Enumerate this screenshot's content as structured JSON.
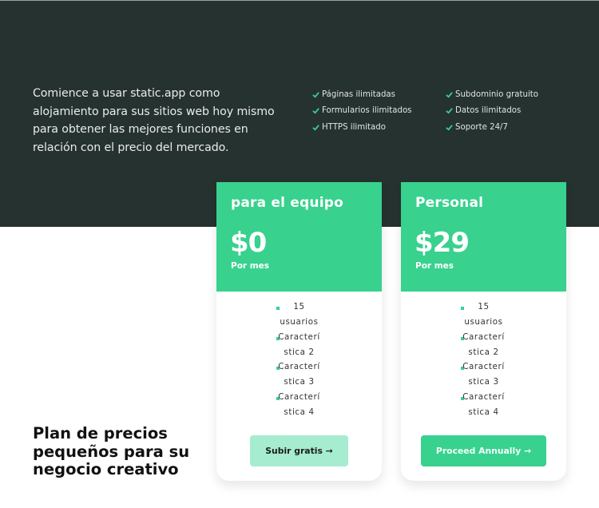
{
  "colors": {
    "dark_bg": "#263230",
    "accent": "#38d18e",
    "accent_light": "#a6ecd0"
  },
  "intro_text": "Comience a usar static.app como alojamiento para sus sitios web hoy mismo para obtener las mejores funciones en relación con el precio del mercado.",
  "features": {
    "col1": [
      "Páginas ilimitadas",
      "Formularios ilimitados",
      "HTTPS ilimitado"
    ],
    "col2": [
      "Subdominio gratuito",
      "Datos ilimitados",
      "Soporte 24/7"
    ]
  },
  "plans": [
    {
      "name": "para el equipo",
      "price": "$0",
      "period": "Por mes",
      "items": [
        [
          "15",
          "usuarios"
        ],
        [
          "Caracterí",
          "stica 2"
        ],
        [
          "Caracterí",
          "stica 3"
        ],
        [
          "Caracterí",
          "stica 4"
        ]
      ],
      "button": "Subir gratis →"
    },
    {
      "name": "Personal",
      "price": "$29",
      "period": "Por mes",
      "items": [
        [
          "15",
          "usuarios"
        ],
        [
          "Caracterí",
          "stica 2"
        ],
        [
          "Caracterí",
          "stica 3"
        ],
        [
          "Caracterí",
          "stica 4"
        ]
      ],
      "button": "Proceed Annually →"
    }
  ],
  "tagline": "Plan de precios pequeños para su negocio creativo"
}
